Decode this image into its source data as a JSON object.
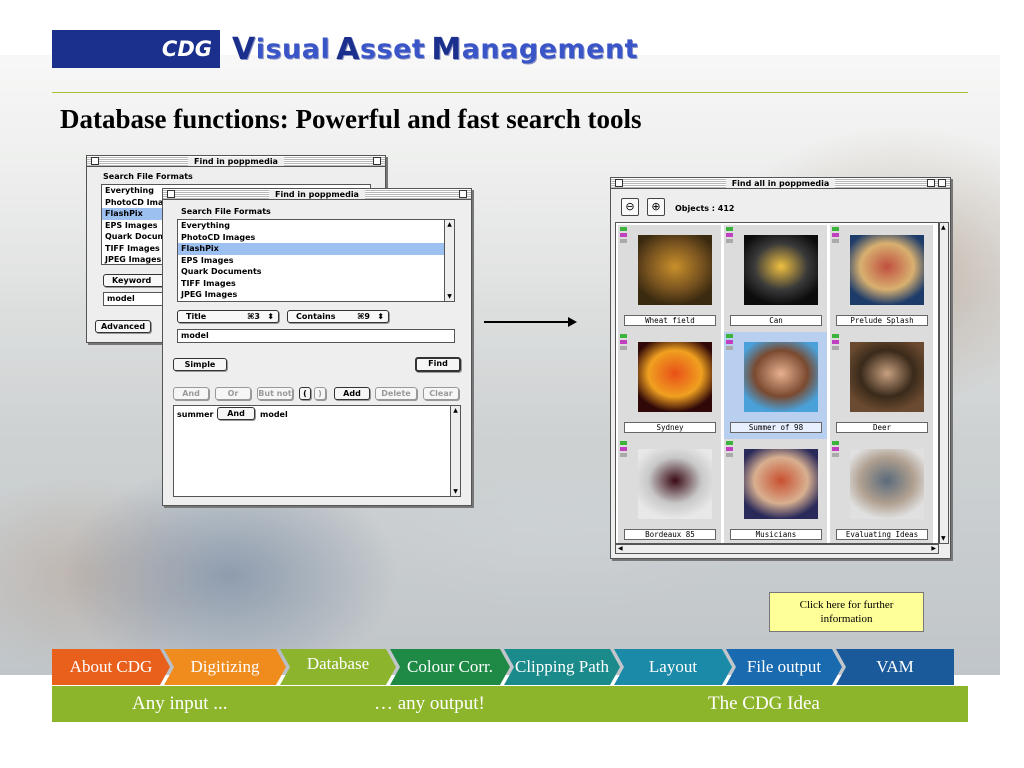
{
  "header": {
    "logo": "CDG",
    "title_parts": [
      {
        "cap": "V",
        "rest": "isual "
      },
      {
        "cap": "A",
        "rest": "sset "
      },
      {
        "cap": "M",
        "rest": "anagement"
      }
    ]
  },
  "slide_title": "Database functions: Powerful and fast search tools",
  "find_window_back": {
    "title": "Find in poppmedia",
    "section": "Search File Formats",
    "formats": [
      "Everything",
      "PhotoCD Imag",
      "FlashPix",
      "EPS Images",
      "Quark Docume",
      "TIFF Images",
      "JPEG Images"
    ],
    "selected_index": 2,
    "keyword_popup": "Keyword",
    "search_value": "model",
    "advanced_button": "Advanced"
  },
  "find_window_front": {
    "title": "Find in poppmedia",
    "section": "Search File Formats",
    "formats": [
      "Everything",
      "PhotoCD Images",
      "FlashPix",
      "EPS Images",
      "Quark Documents",
      "TIFF Images",
      "JPEG Images"
    ],
    "selected_index": 2,
    "field_popup": "Title",
    "field_shortcut": "⌘3",
    "operator_popup": "Contains",
    "operator_shortcut": "⌘9",
    "search_value": "model",
    "simple_button": "Simple",
    "find_button": "Find",
    "logic_buttons": {
      "and": "And",
      "or": "Or",
      "but_not": "But not",
      "open_paren": "(",
      "close_paren": ")",
      "add": "Add",
      "delete": "Delete",
      "clear": "Clear"
    },
    "query": {
      "term1": "summer",
      "op": "And",
      "term2": "model"
    }
  },
  "find_all_window": {
    "title": "Find all in poppmedia",
    "objects_label": "Objects : 412",
    "zoom_out_icon": "zoom-out-icon",
    "zoom_in_icon": "zoom-in-icon",
    "items": [
      {
        "label": "Wheat field",
        "selected": false,
        "palette": [
          "#3a2a10",
          "#c8902a",
          "#7a5420"
        ]
      },
      {
        "label": "Can",
        "selected": false,
        "palette": [
          "#0c0c0c",
          "#f0c040",
          "#3a3a3a"
        ]
      },
      {
        "label": "Prelude Splash",
        "selected": false,
        "palette": [
          "#1e3c6a",
          "#c05040",
          "#d8b070"
        ]
      },
      {
        "label": "Sydney",
        "selected": false,
        "palette": [
          "#300808",
          "#e85018",
          "#f0a020"
        ]
      },
      {
        "label": "Summer of 98",
        "selected": true,
        "palette": [
          "#4aa0d8",
          "#e8b090",
          "#7a4a30"
        ]
      },
      {
        "label": "Deer",
        "selected": false,
        "palette": [
          "#6a4a30",
          "#c8a080",
          "#3a2a1a"
        ]
      },
      {
        "label": "Bordeaux 85",
        "selected": false,
        "palette": [
          "#e8e8e8",
          "#3a0a14",
          "#c8c8c8"
        ]
      },
      {
        "label": "Musicians",
        "selected": false,
        "palette": [
          "#2a2a5a",
          "#c85030",
          "#d8b090"
        ]
      },
      {
        "label": "Evaluating Ideas",
        "selected": false,
        "palette": [
          "#e0e0e0",
          "#5a6a7a",
          "#b0a090"
        ]
      }
    ]
  },
  "info_box": "Click here for further information",
  "nav": {
    "items": [
      {
        "label": "About CDG",
        "color": "#e8601c"
      },
      {
        "label": "Digitizing",
        "color": "#f08c1e"
      },
      {
        "label": "Database",
        "color": "#8cb42c"
      },
      {
        "label": "Colour Corr.",
        "color": "#1e8a46"
      },
      {
        "label": "Clipping Path",
        "color": "#1a8a8a"
      },
      {
        "label": "Layout",
        "color": "#1a8aa8"
      },
      {
        "label": "File output",
        "color": "#1a6ab0"
      },
      {
        "label": "VAM",
        "color": "#1a5a9a"
      }
    ],
    "active_index": 2
  },
  "bottom": {
    "left": "Any input ...",
    "middle": "… any output!",
    "right": "The CDG Idea"
  }
}
